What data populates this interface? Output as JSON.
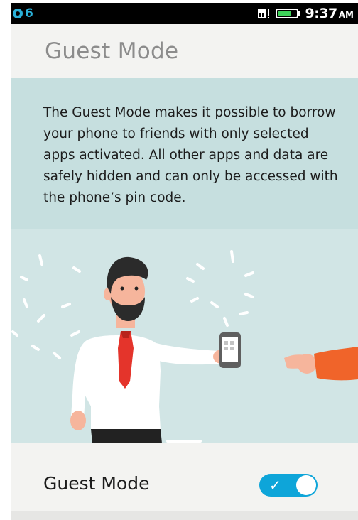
{
  "status_bar": {
    "notification_count": "6",
    "time": "9:37",
    "ampm": "AM",
    "icons": [
      "notification-icon",
      "sim-icon",
      "battery-icon"
    ]
  },
  "header": {
    "title": "Guest Mode"
  },
  "description": "The Guest Mode makes it possible to borrow your phone to friends with only selected apps activated. All other apps and data are safely hidden and can only be accessed with the phone’s pin code.",
  "illustration": {
    "subject": "man handing phone to friend"
  },
  "toggle": {
    "label": "Guest Mode",
    "enabled": true,
    "accent_color": "#0ea5d9"
  },
  "colors": {
    "panel": "#c6dfdf",
    "illustration_bg": "#d1e5e5",
    "header_bg": "#f3f3f1",
    "sleeve": "#f0642a"
  }
}
